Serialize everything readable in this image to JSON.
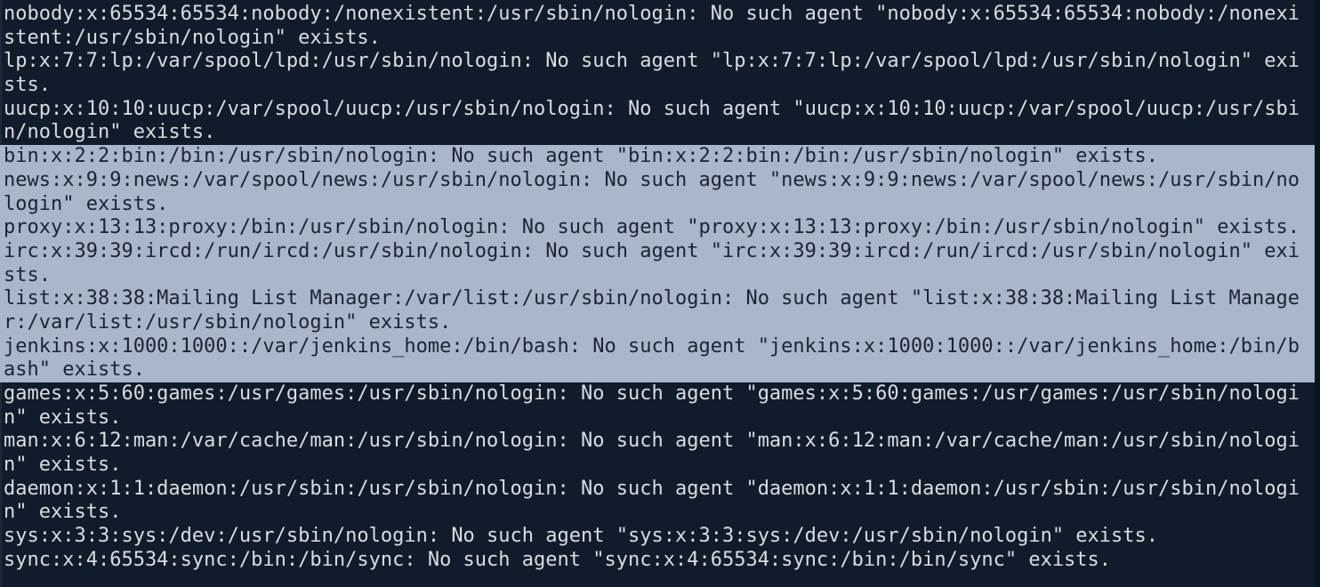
{
  "terminal": {
    "lines": [
      {
        "text": "nobody:x:65534:65534:nobody:/nonexistent:/usr/sbin/nologin: No such agent \"nobody:x:65534:65534:nobody:/nonexi",
        "selected": false
      },
      {
        "text": "stent:/usr/sbin/nologin\" exists.",
        "selected": false
      },
      {
        "text": "lp:x:7:7:lp:/var/spool/lpd:/usr/sbin/nologin: No such agent \"lp:x:7:7:lp:/var/spool/lpd:/usr/sbin/nologin\" exi",
        "selected": false
      },
      {
        "text": "sts.",
        "selected": false
      },
      {
        "text": "uucp:x:10:10:uucp:/var/spool/uucp:/usr/sbin/nologin: No such agent \"uucp:x:10:10:uucp:/var/spool/uucp:/usr/sbi",
        "selected": false
      },
      {
        "text": "n/nologin\" exists.",
        "selected": false
      },
      {
        "text": "bin:x:2:2:bin:/bin:/usr/sbin/nologin: No such agent \"bin:x:2:2:bin:/bin:/usr/sbin/nologin\" exists.",
        "selected": true
      },
      {
        "text": "news:x:9:9:news:/var/spool/news:/usr/sbin/nologin: No such agent \"news:x:9:9:news:/var/spool/news:/usr/sbin/no",
        "selected": true
      },
      {
        "text": "login\" exists.",
        "selected": true
      },
      {
        "text": "proxy:x:13:13:proxy:/bin:/usr/sbin/nologin: No such agent \"proxy:x:13:13:proxy:/bin:/usr/sbin/nologin\" exists.",
        "selected": true
      },
      {
        "text": "irc:x:39:39:ircd:/run/ircd:/usr/sbin/nologin: No such agent \"irc:x:39:39:ircd:/run/ircd:/usr/sbin/nologin\" exi",
        "selected": true
      },
      {
        "text": "sts.",
        "selected": true
      },
      {
        "text": "list:x:38:38:Mailing List Manager:/var/list:/usr/sbin/nologin: No such agent \"list:x:38:38:Mailing List Manage",
        "selected": true
      },
      {
        "text": "r:/var/list:/usr/sbin/nologin\" exists.",
        "selected": true
      },
      {
        "text": "jenkins:x:1000:1000::/var/jenkins_home:/bin/bash: No such agent \"jenkins:x:1000:1000::/var/jenkins_home:/bin/b",
        "selected": true
      },
      {
        "text": "ash\" exists.",
        "selected": true
      },
      {
        "text": "games:x:5:60:games:/usr/games:/usr/sbin/nologin: No such agent \"games:x:5:60:games:/usr/games:/usr/sbin/nologi",
        "selected": false
      },
      {
        "text": "n\" exists.",
        "selected": false
      },
      {
        "text": "man:x:6:12:man:/var/cache/man:/usr/sbin/nologin: No such agent \"man:x:6:12:man:/var/cache/man:/usr/sbin/nologi",
        "selected": false
      },
      {
        "text": "n\" exists.",
        "selected": false
      },
      {
        "text": "daemon:x:1:1:daemon:/usr/sbin:/usr/sbin/nologin: No such agent \"daemon:x:1:1:daemon:/usr/sbin:/usr/sbin/nologi",
        "selected": false
      },
      {
        "text": "n\" exists.",
        "selected": false
      },
      {
        "text": "sys:x:3:3:sys:/dev:/usr/sbin/nologin: No such agent \"sys:x:3:3:sys:/dev:/usr/sbin/nologin\" exists.",
        "selected": false
      },
      {
        "text": "sync:x:4:65534:sync:/bin:/bin/sync: No such agent \"sync:x:4:65534:sync:/bin:/bin/sync\" exists.",
        "selected": false
      }
    ],
    "colors": {
      "background": "#101c29",
      "foreground": "#d7dde4",
      "selection_background": "#aab6cc",
      "selection_foreground": "#1a2433"
    }
  }
}
